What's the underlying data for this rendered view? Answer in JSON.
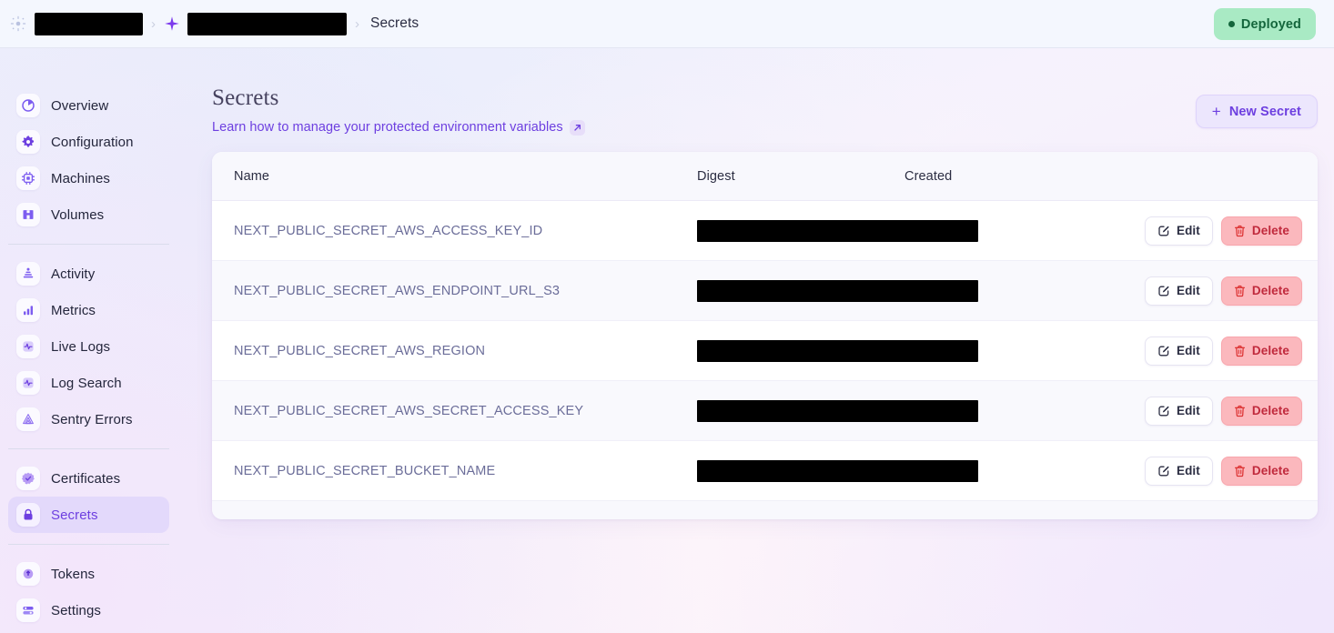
{
  "topbar": {
    "logo_icon": "fly-logo-icon",
    "breadcrumb": [
      {
        "type": "redacted",
        "name": "org-name-redacted"
      },
      {
        "type": "redacted",
        "name": "app-name-redacted",
        "icon": "sparkle-icon"
      },
      {
        "type": "text",
        "label": "Secrets"
      }
    ],
    "separator_icon": "chevron-right-icon",
    "status": {
      "label": "Deployed",
      "color": "#14663c",
      "background": "#a9eac4",
      "dot_icon": "status-dot-icon"
    }
  },
  "sidebar": {
    "groups": [
      {
        "items": [
          {
            "label": "Overview",
            "icon": "pie-chart-icon",
            "active": false
          },
          {
            "label": "Configuration",
            "icon": "gear-icon",
            "active": false
          },
          {
            "label": "Machines",
            "icon": "cpu-chip-icon",
            "active": false
          },
          {
            "label": "Volumes",
            "icon": "database-volume-icon",
            "active": false
          }
        ]
      },
      {
        "items": [
          {
            "label": "Activity",
            "icon": "activity-stack-icon",
            "active": false
          },
          {
            "label": "Metrics",
            "icon": "bar-chart-icon",
            "active": false
          },
          {
            "label": "Live Logs",
            "icon": "pulse-icon",
            "active": false
          },
          {
            "label": "Log Search",
            "icon": "pulse-search-icon",
            "active": false
          },
          {
            "label": "Sentry Errors",
            "icon": "sentry-icon",
            "active": false
          }
        ]
      },
      {
        "items": [
          {
            "label": "Certificates",
            "icon": "badge-check-icon",
            "active": false
          },
          {
            "label": "Secrets",
            "icon": "lock-icon",
            "active": true
          }
        ]
      },
      {
        "items": [
          {
            "label": "Tokens",
            "icon": "key-token-icon",
            "active": false
          },
          {
            "label": "Settings",
            "icon": "sliders-icon",
            "active": false
          }
        ]
      }
    ]
  },
  "main": {
    "title": "Secrets",
    "subtitle_link": "Learn how to manage your protected environment variables",
    "subtitle_link_icon": "external-link-icon",
    "new_secret_button": {
      "label": "New Secret",
      "plus": "+",
      "icon": "plus-icon"
    },
    "table": {
      "columns": [
        "Name",
        "Digest",
        "Created"
      ],
      "row_actions": {
        "edit_label": "Edit",
        "edit_icon": "pencil-square-icon",
        "delete_label": "Delete",
        "delete_icon": "trash-icon"
      },
      "rows": [
        {
          "name": "NEXT_PUBLIC_SECRET_AWS_ACCESS_KEY_ID",
          "digest": "",
          "digest_redacted": true,
          "created": ""
        },
        {
          "name": "NEXT_PUBLIC_SECRET_AWS_ENDPOINT_URL_S3",
          "digest": "",
          "digest_redacted": true,
          "created": ""
        },
        {
          "name": "NEXT_PUBLIC_SECRET_AWS_REGION",
          "digest": "",
          "digest_redacted": true,
          "created": ""
        },
        {
          "name": "NEXT_PUBLIC_SECRET_AWS_SECRET_ACCESS_KEY",
          "digest": "",
          "digest_redacted": true,
          "created": ""
        },
        {
          "name": "NEXT_PUBLIC_SECRET_BUCKET_NAME",
          "digest": "",
          "digest_redacted": true,
          "created": ""
        }
      ]
    }
  },
  "colors": {
    "accent": "#6d3fe0",
    "accent_soft": "#ece6fd",
    "active_nav_bg": "#e3d9fb",
    "danger": "#c0293c",
    "danger_bg": "#fbb8bd",
    "success": "#14663c",
    "success_bg": "#a9eac4",
    "text": "#2b2d42",
    "muted_text": "#6b6d99",
    "card_bg": "#ffffff",
    "row_alt_bg": "#f9f9fd"
  }
}
